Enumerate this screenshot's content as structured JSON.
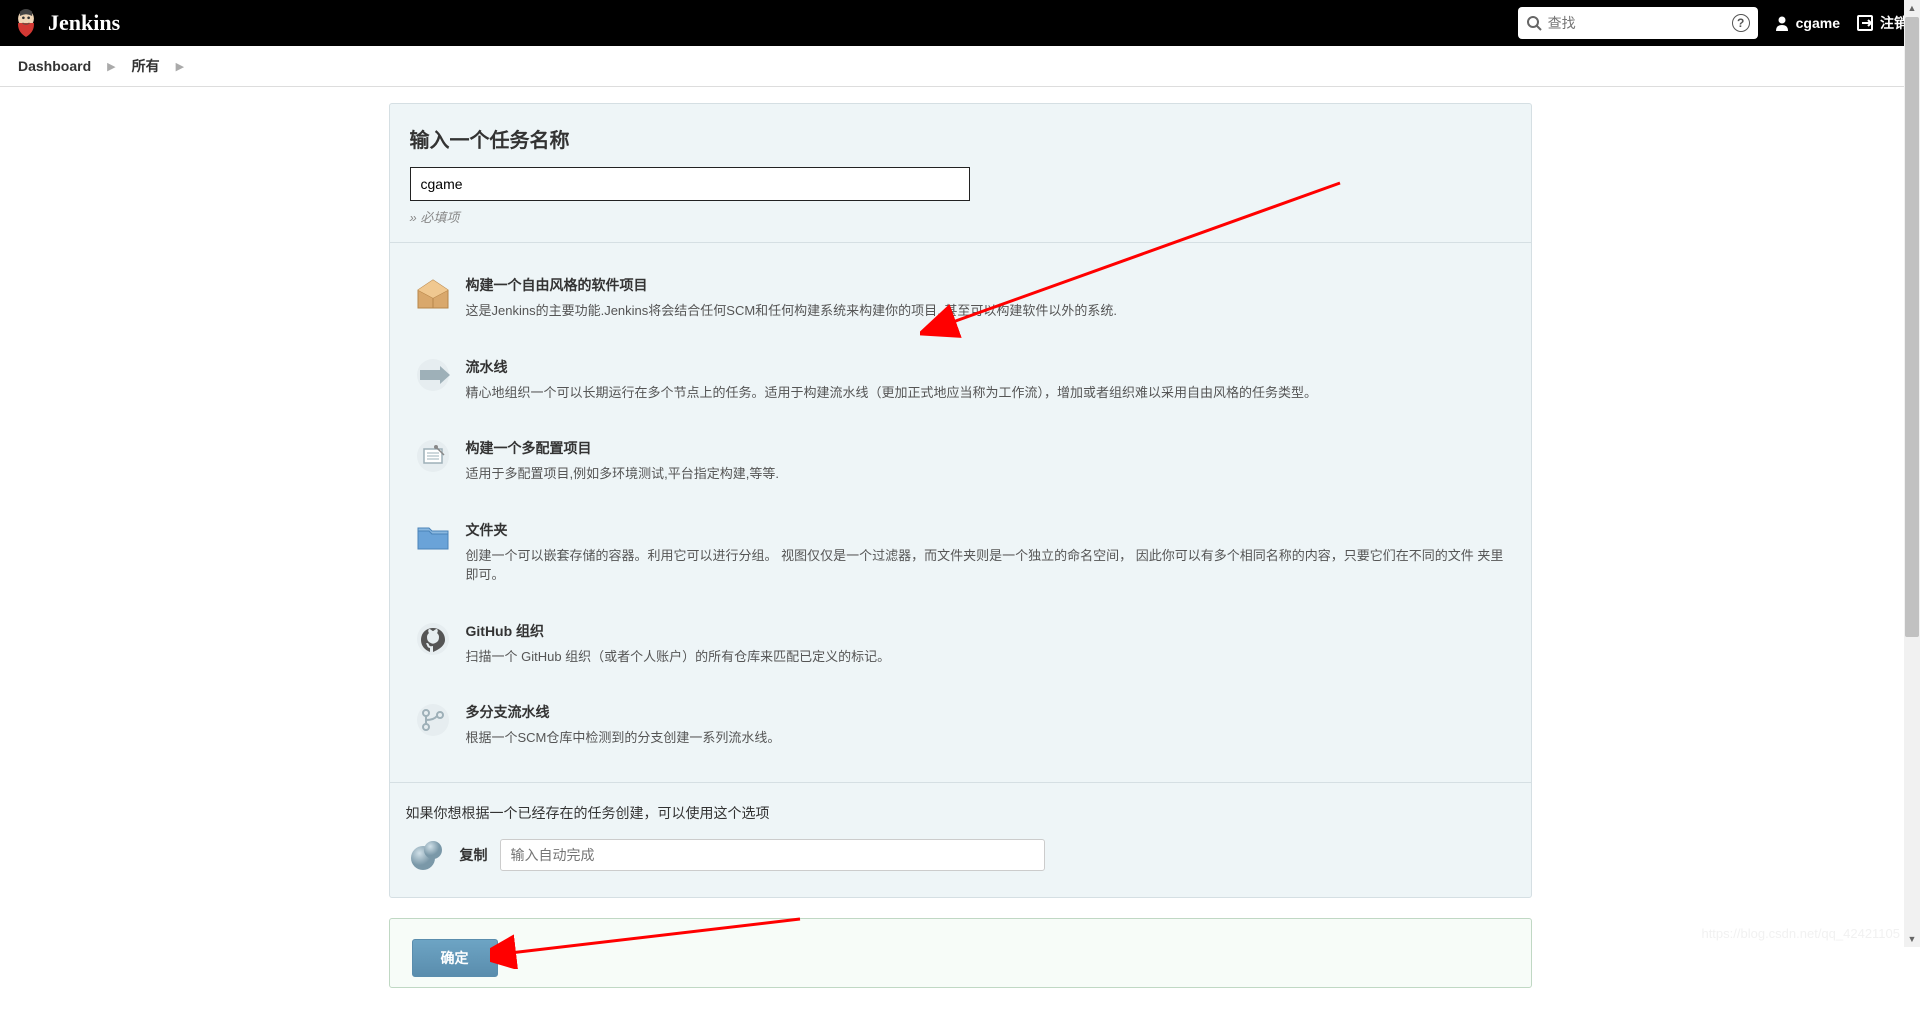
{
  "header": {
    "title": "Jenkins",
    "search_placeholder": "查找",
    "username": "cgame",
    "logout_label": "注销"
  },
  "breadcrumb": {
    "dashboard": "Dashboard",
    "all": "所有"
  },
  "name_section": {
    "heading": "输入一个任务名称",
    "value": "cgame",
    "required_hint": "» 必填项"
  },
  "items": [
    {
      "title": "构建一个自由风格的软件项目",
      "desc": "这是Jenkins的主要功能.Jenkins将会结合任何SCM和任何构建系统来构建你的项目, 甚至可以构建软件以外的系统."
    },
    {
      "title": "流水线",
      "desc": "精心地组织一个可以长期运行在多个节点上的任务。适用于构建流水线（更加正式地应当称为工作流），增加或者组织难以采用自由风格的任务类型。"
    },
    {
      "title": "构建一个多配置项目",
      "desc": "适用于多配置项目,例如多环境测试,平台指定构建,等等."
    },
    {
      "title": "文件夹",
      "desc": "创建一个可以嵌套存储的容器。利用它可以进行分组。 视图仅仅是一个过滤器，而文件夹则是一个独立的命名空间， 因此你可以有多个相同名称的内容，只要它们在不同的文件 夹里即可。"
    },
    {
      "title": "GitHub 组织",
      "desc": "扫描一个 GitHub 组织（或者个人账户）的所有仓库来匹配已定义的标记。"
    },
    {
      "title": "多分支流水线",
      "desc": "根据一个SCM仓库中检测到的分支创建一系列流水线。"
    }
  ],
  "copy_section": {
    "hint": "如果你想根据一个已经存在的任务创建，可以使用这个选项",
    "label": "复制",
    "placeholder": "输入自动完成"
  },
  "submit": {
    "label": "确定"
  },
  "watermark": "https://blog.csdn.net/qq_42421105"
}
